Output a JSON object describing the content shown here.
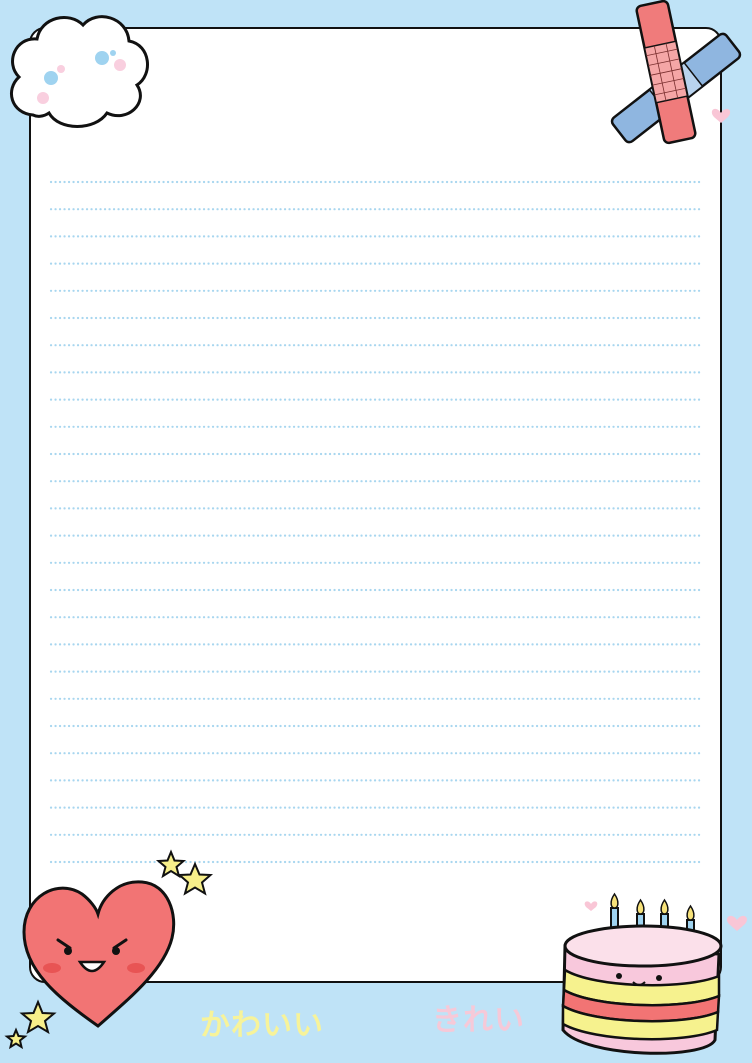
{
  "paper": {
    "line_count": 26,
    "colors": {
      "background": "#bfe3f7",
      "paper": "#ffffff",
      "border": "#111111",
      "dotted_line": "#a8d6ef"
    }
  },
  "decorations": {
    "cloud": "cloud-icon",
    "bandages": "bandage-icon",
    "heart": "smiling-heart-icon",
    "stars": "star-icon",
    "cake": "birthday-cake-icon"
  },
  "captions": {
    "kawaii": "かわいい",
    "kirei": "きれい"
  }
}
